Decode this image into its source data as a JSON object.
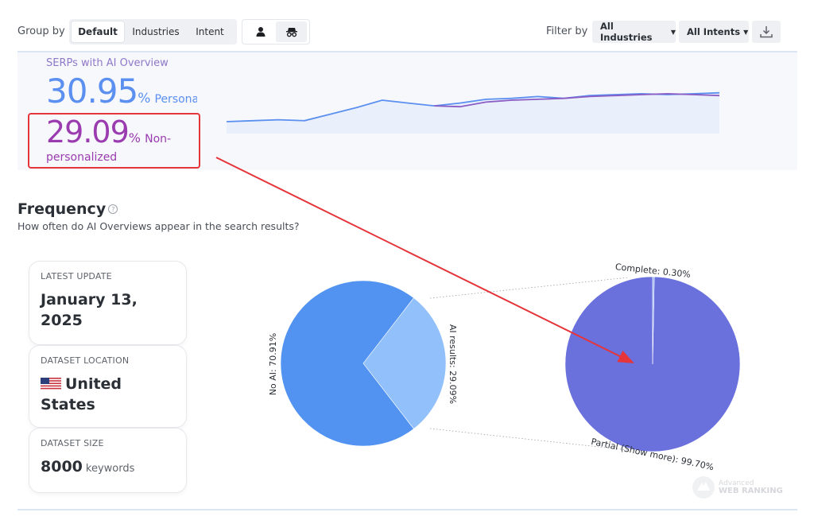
{
  "toolbar": {
    "group_by_label": "Group by",
    "group_options": [
      "Default",
      "Industries",
      "Intent"
    ],
    "active_group": "Default",
    "persona_icons": [
      "person-icon",
      "incognito-icon"
    ],
    "filter_by_label": "Filter by",
    "industry_filter": "All Industries",
    "intent_filter": "All Intents",
    "download_icon": "download-icon"
  },
  "trend": {
    "title": "SERPs with AI Overview",
    "personalized_value": "30.95",
    "personalized_unit": "%",
    "personalized_label": "Personali",
    "nonpersonalized_value": "29.09",
    "nonpersonalized_unit": "%",
    "nonpersonalized_label_line1": "Non-",
    "nonpersonalized_label_line2": "personalized",
    "colors": {
      "personalized": "#5b8ff0",
      "nonpersonalized": "#9a3bb0"
    }
  },
  "frequency": {
    "title": "Frequency",
    "subtitle": "How often do AI Overviews appear in the search results?"
  },
  "cards": {
    "latest_update_label": "LATEST UPDATE",
    "latest_update_value": "January 13, 2025",
    "location_label": "DATASET LOCATION",
    "location_value": "United States",
    "size_label": "DATASET SIZE",
    "size_value": "8000",
    "size_unit": "keywords"
  },
  "chart_data": [
    {
      "type": "line",
      "title": "",
      "series": [
        {
          "values": [
            30.1,
            30.2,
            30.3,
            30.2,
            30.9,
            31.6,
            32.4,
            32.1,
            31.8,
            32.1,
            32.5,
            32.6,
            32.8,
            32.6,
            32.9,
            33.0,
            33.1,
            33.0,
            33.1,
            33.2
          ],
          "color": "#5b8ff0"
        },
        {
          "values": [
            null,
            null,
            null,
            null,
            null,
            null,
            null,
            null,
            31.8,
            31.7,
            32.2,
            32.4,
            32.5,
            32.6,
            32.8,
            32.9,
            33.0,
            33.1,
            33.0,
            32.9
          ],
          "color": "#8a5cc4"
        }
      ]
    },
    {
      "type": "pie",
      "title": "",
      "labels": [
        "No AI",
        "AI results"
      ],
      "values": [
        70.91,
        29.09
      ],
      "label_text": [
        "No AI: 70.91%",
        "AI results: 29.09%"
      ],
      "colors": [
        "#5293f2",
        "#92c0fb"
      ]
    },
    {
      "type": "pie",
      "title": "",
      "labels": [
        "Complete",
        "Partial (Show more)"
      ],
      "values": [
        0.3,
        99.7
      ],
      "label_text": [
        "Complete: 0.30%",
        "Partial (Show more): 99.70%"
      ],
      "colors": [
        "#8fb0f2",
        "#6a70dc"
      ]
    }
  ],
  "annotation": {
    "color": "#e5353b"
  },
  "watermark": {
    "line1": "Advanced",
    "line2": "WEB RANKING"
  }
}
